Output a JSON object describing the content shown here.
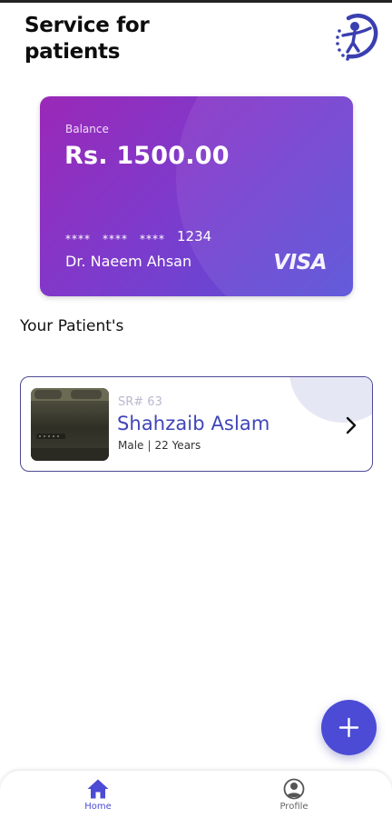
{
  "header": {
    "title_line1": "Service for",
    "title_line2": "patients",
    "logo_icon": "healthcare-person-logo-icon"
  },
  "card": {
    "balance_label": "Balance",
    "balance": "Rs. 1500.00",
    "masked_groups": [
      "****",
      "****",
      "****"
    ],
    "last_digits": "1234",
    "holder": "Dr. Naeem Ahsan",
    "brand": "VISA"
  },
  "patients_section": {
    "heading": "Your Patient's"
  },
  "patients": [
    {
      "sr": "SR# 63",
      "name": "Shahzaib Aslam",
      "gender": "Male",
      "age": "22 Years",
      "open_icon": "chevron-right-icon"
    }
  ],
  "fab": {
    "icon": "plus-icon"
  },
  "bottom_nav": {
    "items": [
      {
        "label": "Home",
        "icon": "home-icon",
        "active": true
      },
      {
        "label": "Profile",
        "icon": "user-circle-icon",
        "active": false
      }
    ]
  },
  "colors": {
    "accent": "#4b4bd6",
    "card_gradient_start": "#9b28b8",
    "card_gradient_end": "#5650d8",
    "patient_name": "#3f45b8",
    "patient_border": "#4e4a94"
  }
}
